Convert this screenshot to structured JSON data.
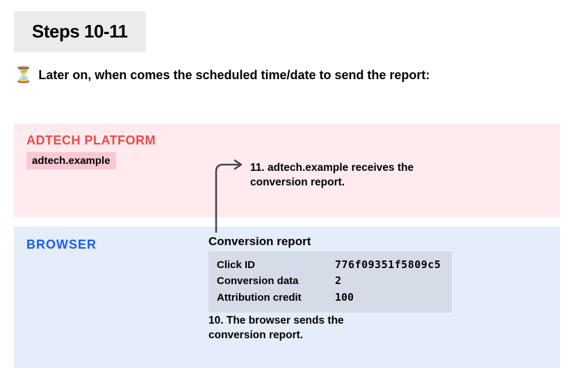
{
  "title": "Steps 10-11",
  "intro": "Later on, when comes the scheduled time/date to send the report:",
  "adtech": {
    "heading": "ADTECH PLATFORM",
    "domain": "adtech.example"
  },
  "browser": {
    "heading": "BROWSER"
  },
  "report": {
    "heading": "Conversion report",
    "rows": {
      "click_id_label": "Click ID",
      "click_id_value": "776f09351f5809c5",
      "conv_data_label": "Conversion data",
      "conv_data_value": "2",
      "attr_credit_label": "Attribution credit",
      "attr_credit_value": "100"
    }
  },
  "step10": "10. The browser sends the conversion report.",
  "step11": "11. adtech.example receives the conversion report."
}
